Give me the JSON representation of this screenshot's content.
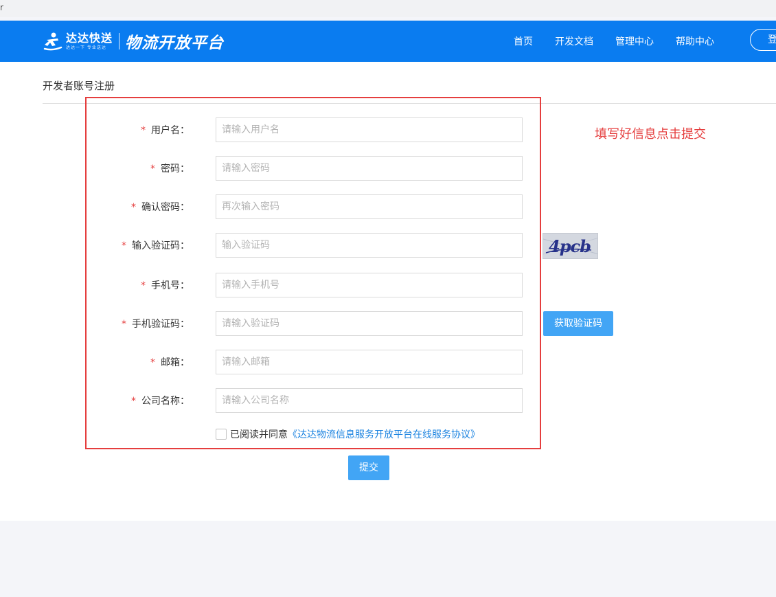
{
  "browser": {
    "tab_fragment": "r"
  },
  "header": {
    "brand_name": "达达快送",
    "brand_slogan": "达达一下 专业送达",
    "platform_name": "物流开放平台",
    "nav": [
      {
        "label": "首页"
      },
      {
        "label": "开发文档"
      },
      {
        "label": "管理中心"
      },
      {
        "label": "帮助中心"
      }
    ],
    "login_label": "登录"
  },
  "page": {
    "title": "开发者账号注册",
    "annotation": "填写好信息点击提交"
  },
  "form": {
    "required_mark": "*",
    "fields": [
      {
        "label": "用户名：",
        "placeholder": "请输入用户名",
        "value": ""
      },
      {
        "label": "密码：",
        "placeholder": "请输入密码",
        "value": ""
      },
      {
        "label": "确认密码：",
        "placeholder": "再次输入密码",
        "value": ""
      },
      {
        "label": "输入验证码：",
        "placeholder": "输入验证码",
        "value": ""
      },
      {
        "label": "手机号：",
        "placeholder": "请输入手机号",
        "value": ""
      },
      {
        "label": "手机验证码：",
        "placeholder": "请输入验证码",
        "value": ""
      },
      {
        "label": "邮箱：",
        "placeholder": "请输入邮箱",
        "value": ""
      },
      {
        "label": "公司名称：",
        "placeholder": "请输入公司名称",
        "value": ""
      }
    ],
    "captcha_text": "4pcb",
    "sms_button_label": "获取验证码",
    "agree_text": "已阅读并同意",
    "agreement_link": "《达达物流信息服务开放平台在线服务协议》",
    "agree_checked": false,
    "submit_label": "提交"
  },
  "colors": {
    "header_bg": "#0a7cf0",
    "button_bg": "#42a5f5",
    "required": "#e53e3e",
    "link": "#1b83e0",
    "highlight_box": "#e53e3e"
  }
}
